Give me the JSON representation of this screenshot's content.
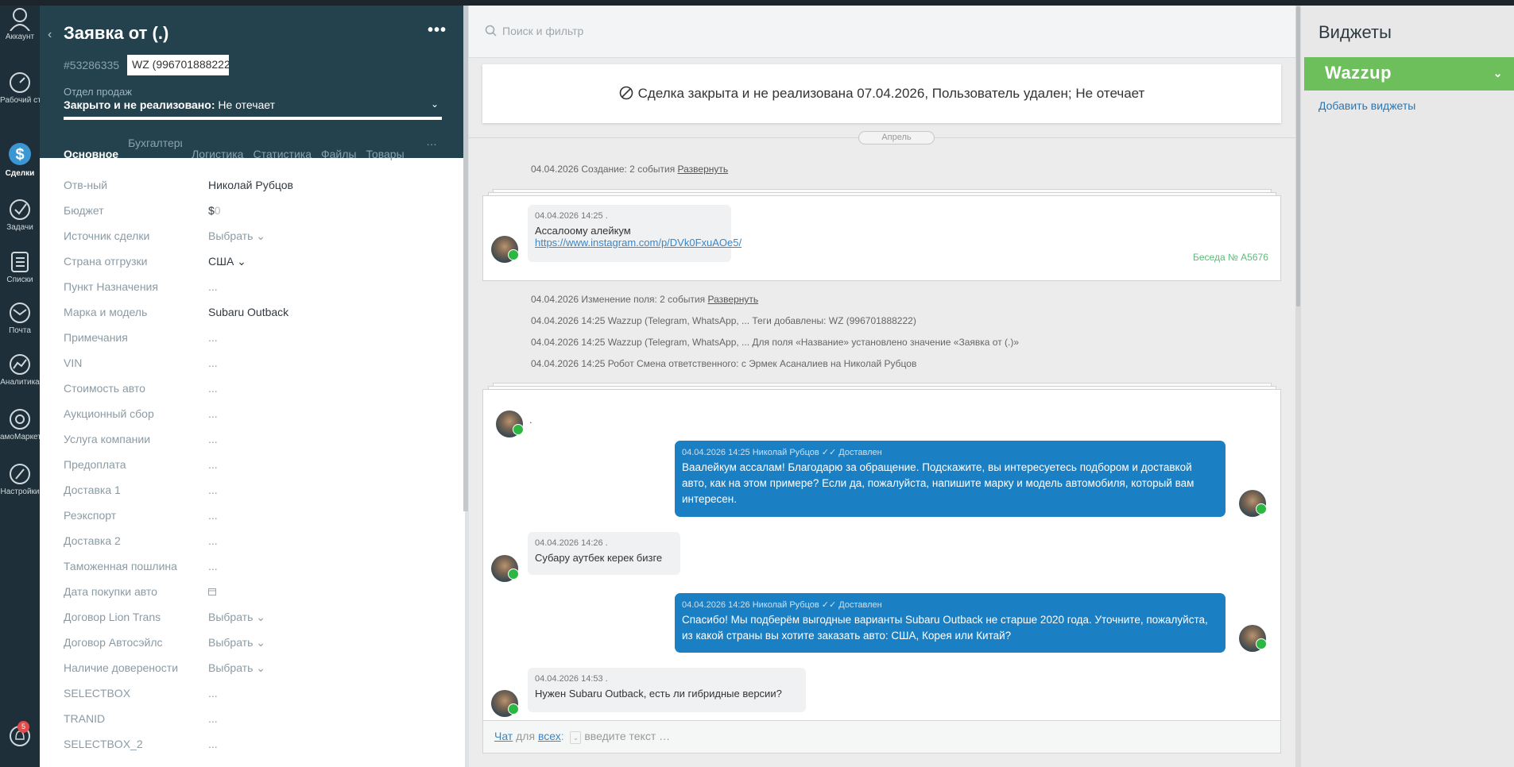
{
  "nav": {
    "items": [
      {
        "label": "Аккаунт",
        "icon": "user-icon"
      },
      {
        "label": "Рабочий стол",
        "icon": "dashboard-icon"
      },
      {
        "label": "Сделки",
        "icon": "deals-icon"
      },
      {
        "label": "Задачи",
        "icon": "tasks-icon"
      },
      {
        "label": "Списки",
        "icon": "lists-icon"
      },
      {
        "label": "Почта",
        "icon": "mail-icon"
      },
      {
        "label": "Аналитика",
        "icon": "analytics-icon"
      },
      {
        "label": "амоМаркет",
        "icon": "market-icon"
      },
      {
        "label": "Настройки",
        "icon": "settings-icon"
      }
    ],
    "notifications_badge": "5"
  },
  "card": {
    "title": "Заявка от (.)",
    "id": "#53286335",
    "tag": "WZ (996701888222)",
    "pipeline_label": "Отдел продаж",
    "status_bold": "Закрыто и не реализовано:",
    "status_reason": " Не отечает",
    "tabs": [
      "Основное",
      "Бухгалтерия",
      "Логистика",
      "Статистика",
      "Файлы",
      "Товары"
    ],
    "more": "…",
    "fields": [
      {
        "key": "Отв-ный",
        "value": "Николай Рубцов"
      },
      {
        "key": "Бюджет",
        "value": "$"
      },
      {
        "key": "Источник сделки",
        "value": "Выбрать"
      },
      {
        "key": "Страна отгрузки",
        "value": "США"
      },
      {
        "key": "Пункт Назначения",
        "value": "..."
      },
      {
        "key": "Марка и модель",
        "value": "Subaru Outback"
      },
      {
        "key": "Примечания",
        "value": "..."
      },
      {
        "key": "VIN",
        "value": "..."
      },
      {
        "key": "Стоимость авто",
        "value": "..."
      },
      {
        "key": "Аукционный сбор",
        "value": "..."
      },
      {
        "key": "Услуга компании",
        "value": "..."
      },
      {
        "key": "Предоплата",
        "value": "..."
      },
      {
        "key": "Доставка 1",
        "value": "..."
      },
      {
        "key": "Реэкспорт",
        "value": "..."
      },
      {
        "key": "Доставка 2",
        "value": "..."
      },
      {
        "key": "Таможенная пошлина",
        "value": "..."
      },
      {
        "key": "Дата покупки авто",
        "value": ""
      },
      {
        "key": "Договор Lion Trans",
        "value": "Выбрать"
      },
      {
        "key": "Договор Автосэйлс",
        "value": "Выбрать"
      },
      {
        "key": "Наличие довереноcти",
        "value": "Выбрать"
      },
      {
        "key": "SELECTBOX",
        "value": "..."
      },
      {
        "key": "TRANID",
        "value": "..."
      },
      {
        "key": "SELECTBOX_2",
        "value": "..."
      }
    ],
    "budget_zero": "0"
  },
  "feed": {
    "search_placeholder": "Поиск и фильтр",
    "closed_text": "Сделка закрыта и не реализована 07.04.2026, Пользователь удален; Не отечает",
    "month": "Апрель",
    "note1_text": "04.04.2026 Создание: 2 события ",
    "note1_link": "Развернуть",
    "msg1": {
      "meta": "04.04.2026 14:25 .",
      "text": "Ассалоому алейкум",
      "link": "https://www.instagram.com/p/DVk0FxuAOe5/"
    },
    "conversation": "Беседа № A5676",
    "note2_text": "04.04.2026 Изменение поля: 2 события ",
    "note2_link": "Развернуть",
    "note3": "04.04.2026 14:25 Wazzup (Telegram, WhatsApp, ... Теги добавлены: WZ (996701888222)",
    "note4": "04.04.2026 14:25 Wazzup (Telegram, WhatsApp, ... Для поля «Название» установлено значение «Заявка от (.)»",
    "note5": "04.04.2026 14:25 Робот Смена ответственного: с Эрмек Асаналиев на Николай Рубцов",
    "dot": ".",
    "out1": {
      "meta": "04.04.2026 14:25 Николай Рубцов ✓✓ Доставлен",
      "text": "Ваалейкум ассалам! Благодарю за обращение. Подскажите, вы интересуетесь подбором и доставкой авто, как на этом примере? Если да, пожалуйста, напишите марку и модель автомобиля, который вам интересен."
    },
    "msg2": {
      "meta": "04.04.2026 14:26 .",
      "text": "Субару аутбек керек бизге"
    },
    "out2": {
      "meta": "04.04.2026 14:26 Николай Рубцов ✓✓ Доставлен",
      "text": "Спасибо! Мы подберём выгодные варианты Subaru Outback не старше 2020 года. Уточните, пожалуйста, из какой страны вы хотите заказать авто: США, Корея или Китай?"
    },
    "msg3": {
      "meta": "04.04.2026 14:53 .",
      "text": "Нужен Subaru Outback, есть ли гибридные версии?"
    },
    "composer": {
      "chat": "Чат",
      "for": " для ",
      "all": "всех",
      "colon": ":",
      "placeholder": " введите текст …"
    }
  },
  "widgets": {
    "title": "Виджеты",
    "wazzup": "Wazzup",
    "add": "Добавить виджеты"
  },
  "colors": {
    "accent": "#1b7fc4",
    "header": "#24414e",
    "wazzup": "#6cbf5b",
    "whatsapp": "#2cb742"
  }
}
